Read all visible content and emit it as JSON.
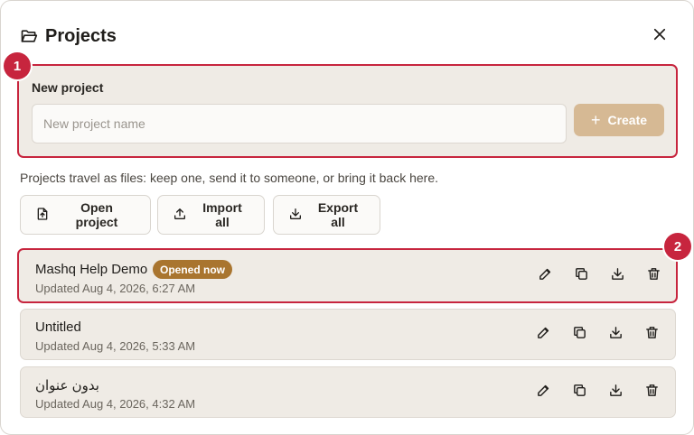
{
  "dialog": {
    "title": "Projects",
    "icons": {
      "title": "folder-open-icon",
      "close": "close-icon"
    }
  },
  "new_project": {
    "label": "New project",
    "input_value": "",
    "input_placeholder": "New project name",
    "create_label": "Create",
    "callout_number": "1"
  },
  "help_text": "Projects travel as files: keep one, send it to someone, or bring it back here.",
  "toolbar": {
    "open_label": "Open project",
    "import_label": "Import all",
    "export_label": "Export all"
  },
  "projects": [
    {
      "name": "Mashq Help Demo",
      "updated": "Updated Aug 4, 2026, 6:27 AM",
      "badge": "Opened now",
      "callout_number": "2"
    },
    {
      "name": "Untitled",
      "updated": "Updated Aug 4, 2026, 5:33 AM"
    },
    {
      "name": "بدون عنوان",
      "updated": "Updated Aug 4, 2026, 4:32 AM"
    }
  ],
  "row_action_icons": [
    "pencil-icon",
    "copy-icon",
    "download-icon",
    "trash-icon"
  ],
  "colors": {
    "highlight": "#c7253e",
    "badge": "#a9752f",
    "create_button": "#d6b994",
    "panel": "#efebe5"
  }
}
